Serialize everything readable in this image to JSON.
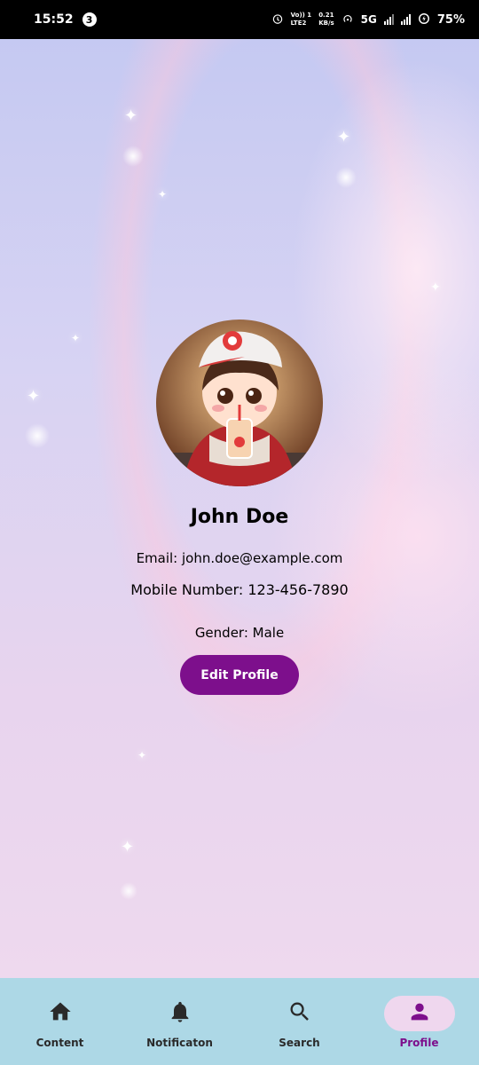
{
  "status_bar": {
    "time": "15:52",
    "notification_count": "3",
    "volte_line1": "Vo)) 1",
    "volte_line2": "LTE2",
    "speed_value": "0.21",
    "speed_unit": "KB/s",
    "network": "5G",
    "battery": "75%"
  },
  "profile": {
    "name": "John Doe",
    "email": "Email: john.doe@example.com",
    "mobile": "Mobile Number: 123-456-7890",
    "gender": "Gender: Male",
    "edit_button": "Edit Profile"
  },
  "bottom_nav": {
    "items": [
      {
        "label": "Content",
        "icon": "home-icon"
      },
      {
        "label": "Notificaton",
        "icon": "bell-icon"
      },
      {
        "label": "Search",
        "icon": "search-icon"
      },
      {
        "label": "Profile",
        "icon": "person-icon"
      }
    ],
    "active_index": 3
  },
  "colors": {
    "accent": "#7d0f8c",
    "nav_background": "#add8e6",
    "active_pill": "#efd7ee"
  }
}
